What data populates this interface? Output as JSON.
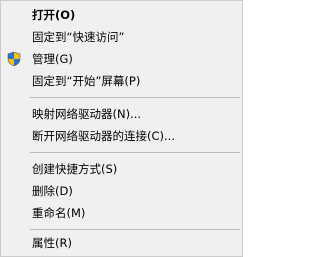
{
  "menu": {
    "items": [
      {
        "label": "打开(O)",
        "bold": true
      },
      {
        "label": "固定到“快速访问”"
      },
      {
        "label": "管理(G)",
        "icon": "uac-shield-icon"
      },
      {
        "label": "固定到“开始”屏幕(P)"
      },
      {
        "label": "映射网络驱动器(N)..."
      },
      {
        "label": "断开网络驱动器的连接(C)..."
      },
      {
        "label": "创建快捷方式(S)"
      },
      {
        "label": "删除(D)"
      },
      {
        "label": "重命名(M)"
      },
      {
        "label": "属性(R)"
      }
    ]
  },
  "colors": {
    "menu_background": "#f0f0f0",
    "separator": "#b9b9b9",
    "shield_blue": "#2f6fcc",
    "shield_yellow": "#f2c21b"
  }
}
